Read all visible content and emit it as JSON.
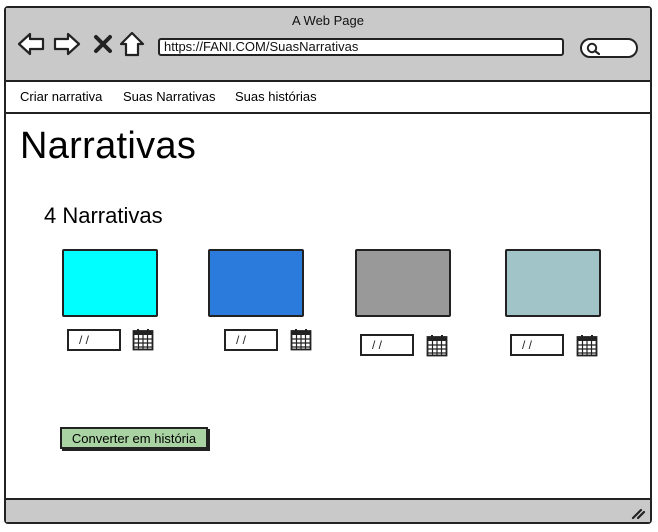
{
  "window": {
    "title": "A Web Page"
  },
  "browser": {
    "url": "https://FANI.COM/SuasNarrativas",
    "icons": [
      "back-arrow-icon",
      "forward-arrow-icon",
      "close-x-icon",
      "home-icon",
      "search-icon"
    ]
  },
  "menu": {
    "items": [
      {
        "label": "Criar narrativa"
      },
      {
        "label": "Suas Narrativas"
      },
      {
        "label": "Suas histórias"
      }
    ]
  },
  "main": {
    "title": "Narrativas",
    "count_label": "4 Narrativas",
    "narratives": [
      {
        "color": "#00ffff",
        "date": "/ /"
      },
      {
        "color": "#2b7bdc",
        "date": "/ /"
      },
      {
        "color": "#999999",
        "date": "/ /"
      },
      {
        "color": "#a1c4c9",
        "date": "/ /"
      }
    ],
    "convert_button": "Converter em história"
  },
  "colors": {
    "chrome": "#c9c9c9",
    "button_green": "#a9d3a2"
  }
}
